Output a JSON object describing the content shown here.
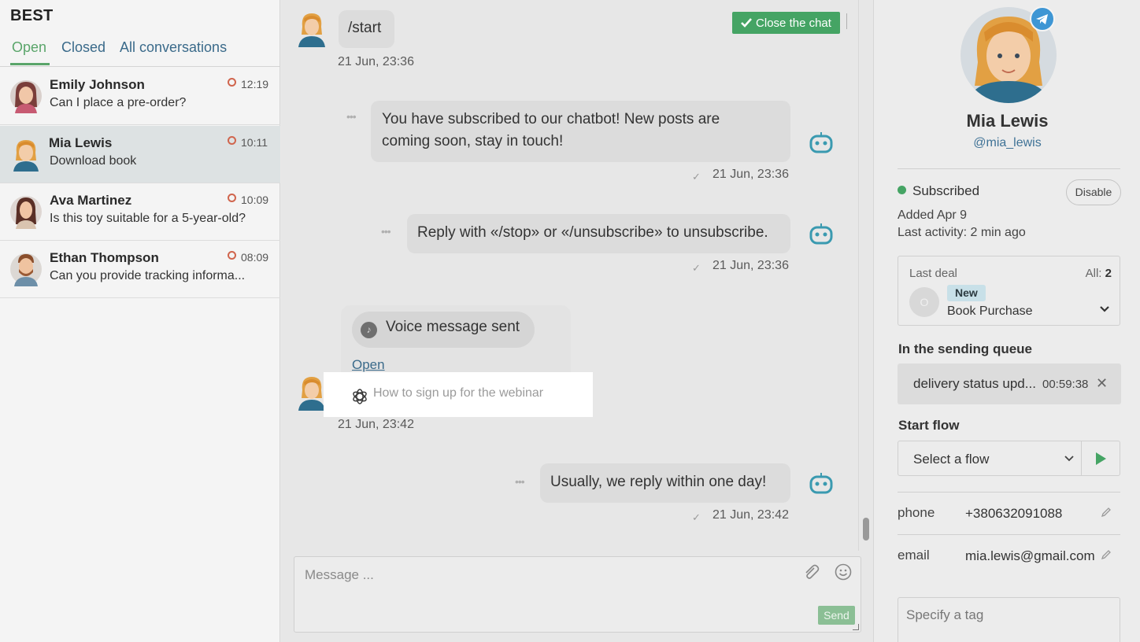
{
  "sidebar": {
    "brand": "BEST",
    "tabs": [
      "Open",
      "Closed",
      "All conversations"
    ],
    "conversations": [
      {
        "name": "Emily Johnson",
        "preview": "Can I place a pre-order?",
        "time": "12:19"
      },
      {
        "name": "Mia Lewis",
        "preview": "Download book",
        "time": "10:11"
      },
      {
        "name": "Ava Martinez",
        "preview": "Is this toy suitable for a 5-year-old?",
        "time": "10:09"
      },
      {
        "name": "Ethan Thompson",
        "preview": "Can you provide tracking informa...",
        "time": "08:09"
      }
    ]
  },
  "chat": {
    "close_label": "Close the chat",
    "messages": {
      "start_text": "/start",
      "start_time": "21 Jun, 23:36",
      "sub_line1": "You have subscribed to our chatbot! New posts are",
      "sub_line2": "coming soon, stay in touch!",
      "sub_time": "21 Jun, 23:36",
      "reply_text": "Reply with «/stop» or «/unsubscribe» to unsubscribe.",
      "reply_time": "21 Jun, 23:36",
      "voice_text": "Voice message sent",
      "voice_open": "Open",
      "ai_suggestion": "How to sign up for the webinar",
      "voice_time": "21 Jun, 23:42",
      "usual_text": "Usually, we reply within one day!",
      "usual_time": "21 Jun, 23:42"
    },
    "composer": {
      "placeholder": "Message ...",
      "send_label": "Send"
    }
  },
  "profile": {
    "name": "Mia Lewis",
    "handle": "@mia_lewis",
    "status": "Subscribed",
    "disable_label": "Disable",
    "added": "Added Apr 9",
    "last_activity": "Last activity: 2 min ago",
    "deal": {
      "label": "Last deal",
      "all_label": "All:",
      "all_count": "2",
      "avatar_letter": "O",
      "badge": "New",
      "name": "Book Purchase"
    },
    "queue_title": "In the sending queue",
    "queue": {
      "text": "delivery status upd...",
      "time": "00:59:38"
    },
    "flow_title": "Start flow",
    "flow_placeholder": "Select a flow",
    "fields": [
      {
        "label": "phone",
        "value": "+380632091088"
      },
      {
        "label": "email",
        "value": "mia.lewis@gmail.com"
      }
    ],
    "tag_placeholder": "Specify a tag"
  },
  "colors": {
    "accent_green": "#45a464",
    "link_blue": "#3a6a8a",
    "telegram_blue": "#3e96d4",
    "bot_teal": "#3a9ab0",
    "status_orange": "#d0654d"
  }
}
